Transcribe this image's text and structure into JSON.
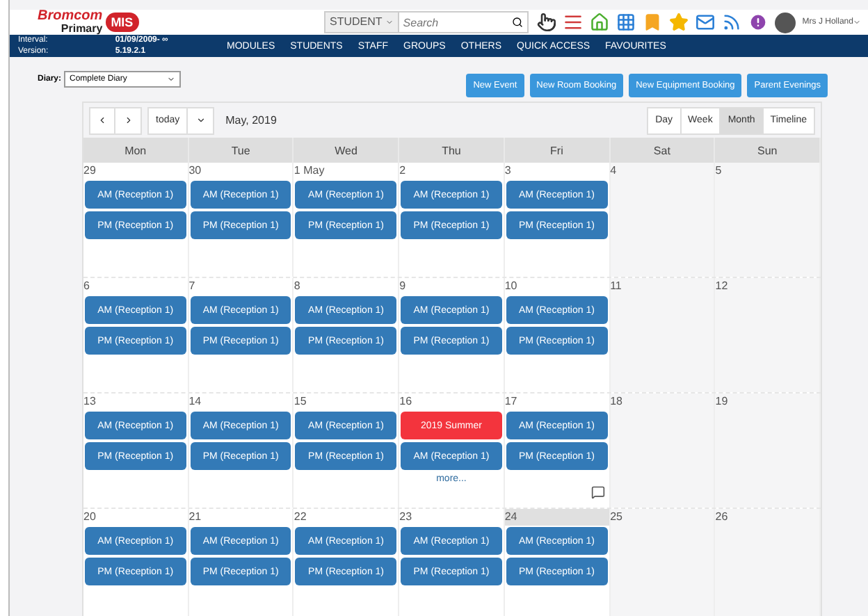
{
  "header": {
    "logo": {
      "brand": "Bromcom",
      "product": "Primary",
      "badge": "MIS"
    },
    "search": {
      "scope": "STUDENT",
      "placeholder": "Search"
    },
    "user": "Mrs J Holland"
  },
  "nav": {
    "interval_label": "Interval:",
    "interval": "01/09/2009- ∞",
    "version_label": "Version:",
    "version": "5.19.2.1",
    "items": [
      "MODULES",
      "STUDENTS",
      "STAFF",
      "GROUPS",
      "OTHERS",
      "QUICK ACCESS",
      "FAVOURITES"
    ]
  },
  "diary": {
    "label": "Diary:",
    "value": "Complete Diary"
  },
  "actions": [
    "New Event",
    "New Room Booking",
    "New Equipment Booking",
    "Parent Evenings"
  ],
  "calendar": {
    "today_button": "today",
    "title": "May, 2019",
    "views": [
      {
        "label": "Day",
        "selected": false
      },
      {
        "label": "Week",
        "selected": false
      },
      {
        "label": "Month",
        "selected": true
      },
      {
        "label": "Timeline",
        "selected": false
      }
    ],
    "weekdays": [
      "Mon",
      "Tue",
      "Wed",
      "Thu",
      "Fri",
      "Sat",
      "Sun"
    ],
    "weeks": [
      {
        "days": [
          {
            "date": "29",
            "today": false,
            "events": [
              {
                "label": "AM (Reception 1)",
                "color": "#337ab7"
              },
              {
                "label": "PM (Reception 1)",
                "color": "#337ab7"
              }
            ]
          },
          {
            "date": "30",
            "today": false,
            "events": [
              {
                "label": "AM (Reception 1)",
                "color": "#337ab7"
              },
              {
                "label": "PM (Reception 1)",
                "color": "#337ab7"
              }
            ]
          },
          {
            "date": "1 May",
            "today": false,
            "events": [
              {
                "label": "AM (Reception 1)",
                "color": "#337ab7"
              },
              {
                "label": "PM (Reception 1)",
                "color": "#337ab7"
              }
            ]
          },
          {
            "date": "2",
            "today": false,
            "events": [
              {
                "label": "AM (Reception 1)",
                "color": "#337ab7"
              },
              {
                "label": "PM (Reception 1)",
                "color": "#337ab7"
              }
            ]
          },
          {
            "date": "3",
            "today": false,
            "events": [
              {
                "label": "AM (Reception 1)",
                "color": "#337ab7"
              },
              {
                "label": "PM (Reception 1)",
                "color": "#337ab7"
              }
            ]
          },
          {
            "date": "4",
            "today": false
          },
          {
            "date": "5",
            "today": false
          }
        ]
      },
      {
        "days": [
          {
            "date": "6",
            "today": false,
            "events": [
              {
                "label": "AM (Reception 1)",
                "color": "#337ab7"
              },
              {
                "label": "PM (Reception 1)",
                "color": "#337ab7"
              }
            ]
          },
          {
            "date": "7",
            "today": false,
            "events": [
              {
                "label": "AM (Reception 1)",
                "color": "#337ab7"
              },
              {
                "label": "PM (Reception 1)",
                "color": "#337ab7"
              }
            ]
          },
          {
            "date": "8",
            "today": false,
            "events": [
              {
                "label": "AM (Reception 1)",
                "color": "#337ab7"
              },
              {
                "label": "PM (Reception 1)",
                "color": "#337ab7"
              }
            ]
          },
          {
            "date": "9",
            "today": false,
            "events": [
              {
                "label": "AM (Reception 1)",
                "color": "#337ab7"
              },
              {
                "label": "PM (Reception 1)",
                "color": "#337ab7"
              }
            ]
          },
          {
            "date": "10",
            "today": false,
            "events": [
              {
                "label": "AM (Reception 1)",
                "color": "#337ab7"
              },
              {
                "label": "PM (Reception 1)",
                "color": "#337ab7"
              }
            ]
          },
          {
            "date": "11",
            "today": false
          },
          {
            "date": "12",
            "today": false
          }
        ]
      },
      {
        "days": [
          {
            "date": "13",
            "today": false,
            "events": [
              {
                "label": "AM (Reception 1)",
                "color": "#337ab7"
              },
              {
                "label": "PM (Reception 1)",
                "color": "#337ab7"
              }
            ]
          },
          {
            "date": "14",
            "today": false,
            "events": [
              {
                "label": "AM (Reception 1)",
                "color": "#337ab7"
              },
              {
                "label": "PM (Reception 1)",
                "color": "#337ab7"
              }
            ]
          },
          {
            "date": "15",
            "today": false,
            "events": [
              {
                "label": "AM (Reception 1)",
                "color": "#337ab7"
              },
              {
                "label": "PM (Reception 1)",
                "color": "#337ab7"
              }
            ]
          },
          {
            "date": "16",
            "today": false,
            "events": [
              {
                "label": "2019 Summer",
                "color": "#f3343d"
              },
              {
                "label": "AM (Reception 1)",
                "color": "#337ab7"
              }
            ],
            "more": "more..."
          },
          {
            "date": "17",
            "today": false,
            "events": [
              {
                "label": "AM (Reception 1)",
                "color": "#337ab7"
              },
              {
                "label": "PM (Reception 1)",
                "color": "#337ab7"
              }
            ]
          },
          {
            "date": "18",
            "today": false
          },
          {
            "date": "19",
            "today": false
          }
        ]
      },
      {
        "days": [
          {
            "date": "20",
            "today": false,
            "events": [
              {
                "label": "AM (Reception 1)",
                "color": "#337ab7"
              },
              {
                "label": "PM (Reception 1)",
                "color": "#337ab7"
              }
            ]
          },
          {
            "date": "21",
            "today": false,
            "events": [
              {
                "label": "AM (Reception 1)",
                "color": "#337ab7"
              },
              {
                "label": "PM (Reception 1)",
                "color": "#337ab7"
              }
            ]
          },
          {
            "date": "22",
            "today": false,
            "events": [
              {
                "label": "AM (Reception 1)",
                "color": "#337ab7"
              },
              {
                "label": "PM (Reception 1)",
                "color": "#337ab7"
              }
            ]
          },
          {
            "date": "23",
            "today": false,
            "events": [
              {
                "label": "AM (Reception 1)",
                "color": "#337ab7"
              },
              {
                "label": "PM (Reception 1)",
                "color": "#337ab7"
              }
            ]
          },
          {
            "date": "24",
            "today": true,
            "events": [
              {
                "label": "AM (Reception 1)",
                "color": "#337ab7"
              },
              {
                "label": "PM (Reception 1)",
                "color": "#337ab7"
              }
            ]
          },
          {
            "date": "25",
            "today": false
          },
          {
            "date": "26",
            "today": false
          }
        ]
      }
    ]
  }
}
